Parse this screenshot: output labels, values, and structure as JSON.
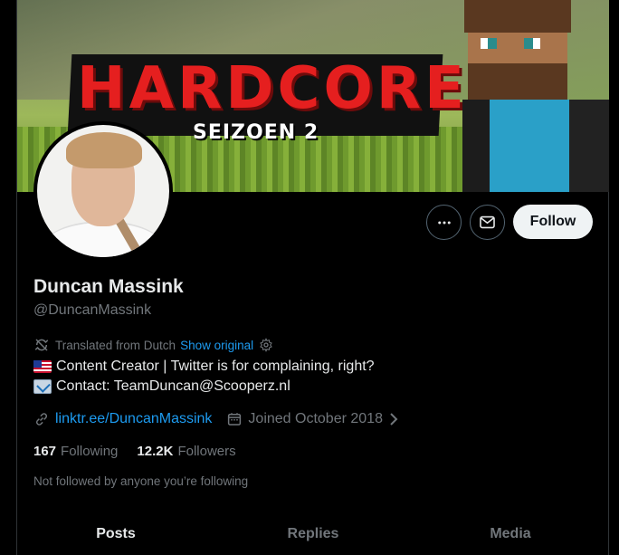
{
  "banner": {
    "title": "HARDCORE",
    "subtitle": "SEIZOEN 2"
  },
  "profile": {
    "name": "Duncan Massink",
    "handle": "@DuncanMassink",
    "follow_label": "Follow"
  },
  "translation": {
    "text": "Translated from Dutch",
    "show_original": "Show original"
  },
  "bio": {
    "line1": "Content Creator | Twitter is for complaining, right?",
    "line2": "Contact: TeamDuncan@Scooperz.nl"
  },
  "meta": {
    "link": "linktr.ee/DuncanMassink",
    "joined": "Joined October 2018"
  },
  "counts": {
    "following_num": "167",
    "following_label": "Following",
    "followers_num": "12.2K",
    "followers_label": "Followers"
  },
  "not_followed": "Not followed by anyone you’re following",
  "tabs": [
    {
      "label": "Posts"
    },
    {
      "label": "Replies"
    },
    {
      "label": "Media"
    }
  ],
  "colors": {
    "accent": "#1d9bf0",
    "background": "#000000",
    "muted": "#71767b",
    "text": "#e7e9ea"
  },
  "icons": [
    "more-icon",
    "mail-icon",
    "translate-icon",
    "gear-icon",
    "link-icon",
    "calendar-icon",
    "chevron-right-icon"
  ]
}
